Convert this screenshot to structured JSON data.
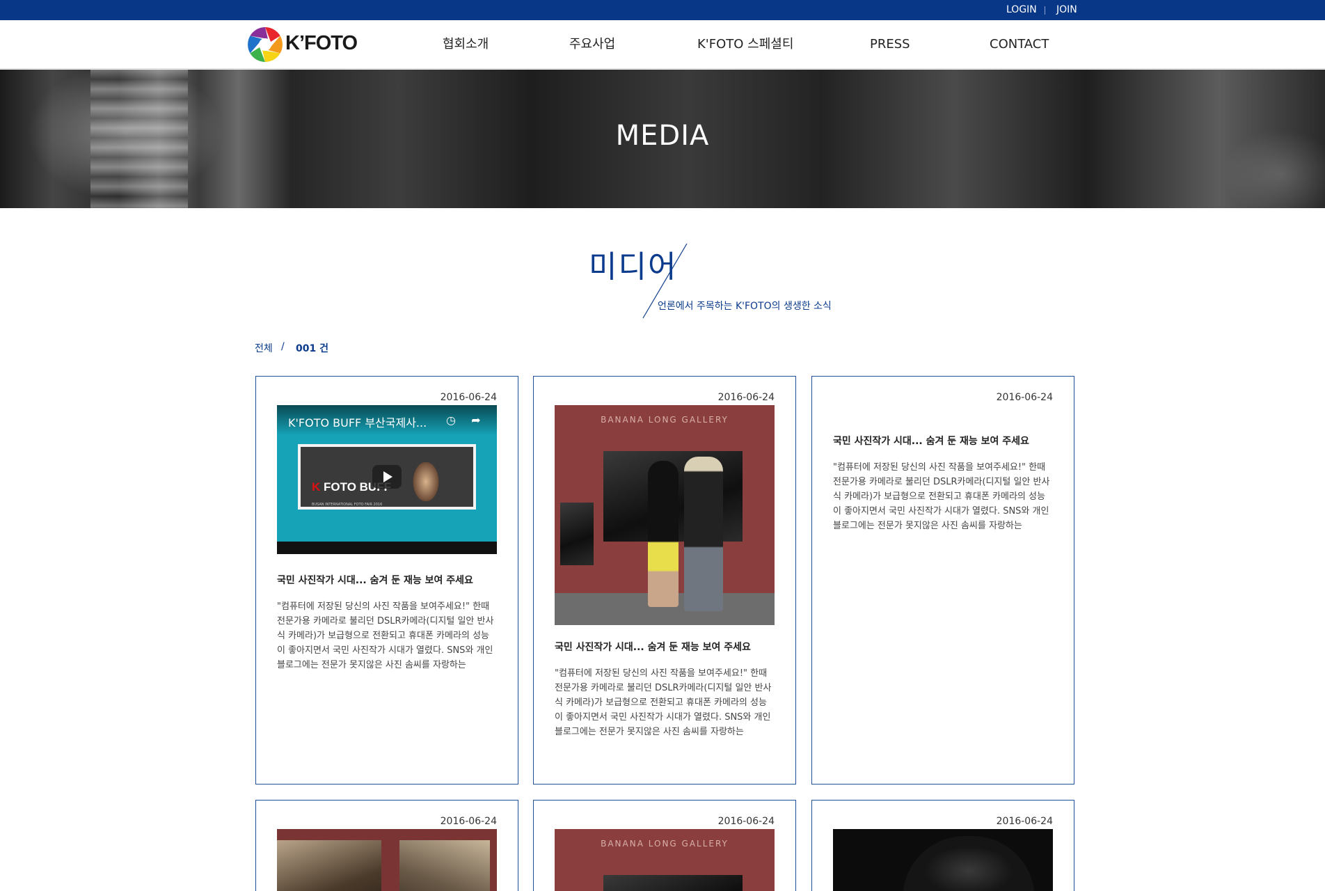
{
  "topbar": {
    "login": "LOGIN",
    "join": "JOIN"
  },
  "header": {
    "logo_text": "K’FOTO",
    "nav": [
      "협회소개",
      "주요사업",
      "K'FOTO 스페셜티",
      "PRESS",
      "CONTACT"
    ]
  },
  "hero": {
    "title": "MEDIA"
  },
  "section": {
    "title": "미디어",
    "subtitle": "언론에서 주목하는 K'FOTO의 생생한 소식"
  },
  "breadcrumb": {
    "all": "전체",
    "separator": "/",
    "count": "001 건"
  },
  "cards": [
    {
      "date": "2016-06-24",
      "thumb_type": "video",
      "video_title": "K'FOTO BUFF 부산국제사...",
      "poster_text_k": "K",
      "poster_text_rest": " FOTO BUFF",
      "poster_small": "BUSAN INTERNATIONAL FOTO FAIR 2016",
      "title": "국민 사진작가 시대... 숨겨 둔 재능 보여 주세요",
      "body": "\"컴퓨터에 저장된 당신의 사진 작품을 보여주세요!\" 한때 전문가용 카메라로 불리던 DSLR카메라(디지털 일안 반사식 카메라)가 보급형으로 전환되고 휴대폰 카메라의 성능이 좋아지면서 국민 사진작가 시대가 열렸다. SNS와 개인 블로그에는 전문가 못지않은 사진 솜씨를 자랑하는"
    },
    {
      "date": "2016-06-24",
      "thumb_type": "gallery",
      "gallery_label": "BANANA LONG GALLERY",
      "title": "국민 사진작가 시대... 숨겨 둔 재능 보여 주세요",
      "body": "\"컴퓨터에 저장된 당신의 사진 작품을 보여주세요!\" 한때 전문가용 카메라로 불리던 DSLR카메라(디지털 일안 반사식 카메라)가 보급형으로 전환되고 휴대폰 카메라의 성능이 좋아지면서 국민 사진작가 시대가 열렸다. SNS와 개인 블로그에는 전문가 못지않은 사진 솜씨를 자랑하는"
    },
    {
      "date": "2016-06-24",
      "thumb_type": "none",
      "title": "국민 사진작가 시대... 숨겨 둔 재능 보여 주세요",
      "body": "\"컴퓨터에 저장된 당신의 사진 작품을 보여주세요!\" 한때 전문가용 카메라로 불리던 DSLR카메라(디지털 일안 반사식 카메라)가 보급형으로 전환되고 휴대폰 카메라의 성능이 좋아지면서 국민 사진작가 시대가 열렸다. SNS와 개인 블로그에는 전문가 못지않은 사진 솜씨를 자랑하는"
    },
    {
      "date": "2016-06-24",
      "thumb_type": "artwork"
    },
    {
      "date": "2016-06-24",
      "thumb_type": "gallery",
      "gallery_label": "BANANA LONG GALLERY"
    },
    {
      "date": "2016-06-24",
      "thumb_type": "dark"
    }
  ],
  "colors": {
    "brand_blue": "#073786",
    "accent_blue": "#0b3b8c",
    "card_border": "#1f4f9c"
  }
}
